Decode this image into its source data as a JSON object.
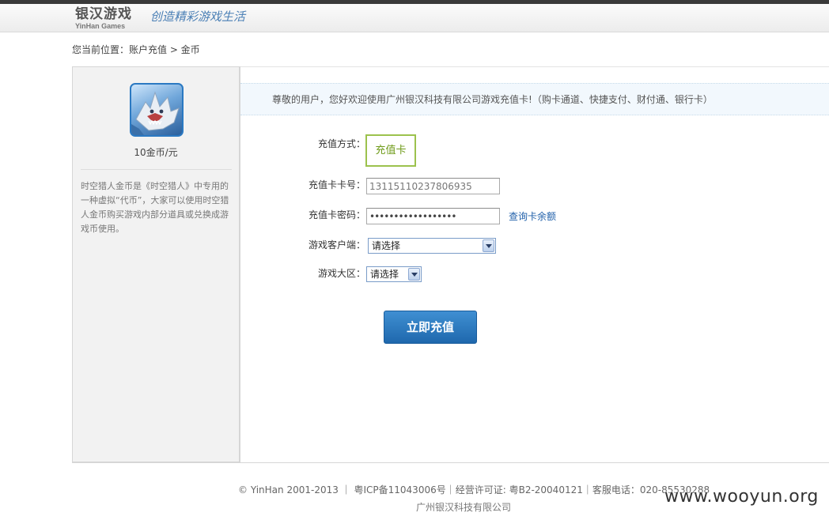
{
  "header": {
    "logo_cn": "银汉游戏",
    "logo_en": "YinHan  Games",
    "slogan": "创造精彩游戏生活"
  },
  "breadcrumb": "您当前位置：账户充值 > 金币",
  "sidebar": {
    "price": "10金币/元",
    "description": "时空猎人金币是《时空猎人》中专用的一种虚拟“代币”，大家可以使用时空猎人金币购买游戏内部分道具或兑换成游戏币使用。"
  },
  "welcome": "尊敬的用户，您好欢迎使用广州银汉科技有限公司游戏充值卡!（购卡通道、快捷支付、财付通、银行卡）",
  "form": {
    "method_label": "充值方式：",
    "method_value": "充值卡",
    "card_no_label": "充值卡卡号：",
    "card_no_value": "13115110237806935",
    "card_pwd_label": "充值卡密码：",
    "card_pwd_value": "••••••••••••••••••",
    "balance_link": "查询卡余额",
    "client_label": "游戏客户端：",
    "client_value": "请选择",
    "zone_label": "游戏大区：",
    "zone_value": "请选择",
    "submit": "立即充值"
  },
  "footer": {
    "line1": "© YinHan 2001-2013 ｜ 粤ICP备11043006号｜经营许可证: 粤B2-20040121｜客服电话：020-85530288",
    "line2": "广州银汉科技有限公司"
  },
  "watermark": "www.wooyun.org",
  "colors": {
    "accent_blue": "#1f68ad",
    "method_green": "#9cc24d",
    "link_blue": "#1f5fa9"
  }
}
